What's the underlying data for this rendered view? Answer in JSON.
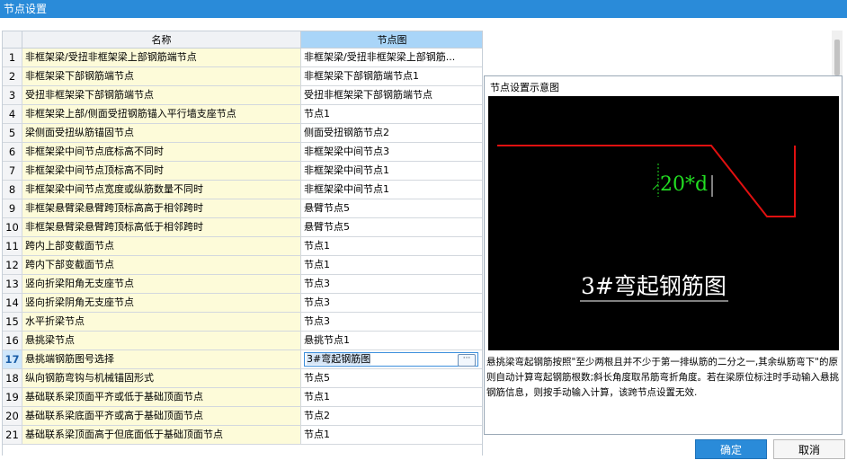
{
  "window": {
    "title": "节点设置"
  },
  "grid": {
    "header_name": "名称",
    "header_node": "节点图",
    "rows": [
      {
        "num": "1",
        "name": "非框架梁/受扭非框架梁上部钢筋端节点",
        "node": "非框架梁/受扭非框架梁上部钢筋..."
      },
      {
        "num": "2",
        "name": "非框架梁下部钢筋端节点",
        "node": "非框架梁下部钢筋端节点1"
      },
      {
        "num": "3",
        "name": "受扭非框架梁下部钢筋端节点",
        "node": "受扭非框架梁下部钢筋端节点"
      },
      {
        "num": "4",
        "name": "非框架梁上部/侧面受扭钢筋锚入平行墙支座节点",
        "node": "节点1"
      },
      {
        "num": "5",
        "name": "梁侧面受扭纵筋锚固节点",
        "node": "侧面受扭钢筋节点2"
      },
      {
        "num": "6",
        "name": "非框架梁中间节点底标高不同时",
        "node": "非框架梁中间节点3"
      },
      {
        "num": "7",
        "name": "非框架梁中间节点顶标高不同时",
        "node": "非框架梁中间节点1"
      },
      {
        "num": "8",
        "name": "非框架梁中间节点宽度或纵筋数量不同时",
        "node": "非框架梁中间节点1"
      },
      {
        "num": "9",
        "name": "非框架悬臂梁悬臂跨顶标高高于相邻跨时",
        "node": "悬臂节点5"
      },
      {
        "num": "10",
        "name": "非框架悬臂梁悬臂跨顶标高低于相邻跨时",
        "node": "悬臂节点5"
      },
      {
        "num": "11",
        "name": "跨内上部变截面节点",
        "node": "节点1"
      },
      {
        "num": "12",
        "name": "跨内下部变截面节点",
        "node": "节点1"
      },
      {
        "num": "13",
        "name": "竖向折梁阳角无支座节点",
        "node": "节点3"
      },
      {
        "num": "14",
        "name": "竖向折梁阴角无支座节点",
        "node": "节点3"
      },
      {
        "num": "15",
        "name": "水平折梁节点",
        "node": "节点3"
      },
      {
        "num": "16",
        "name": "悬挑梁节点",
        "node": "悬挑节点1"
      },
      {
        "num": "17",
        "name": "悬挑端钢筋图号选择",
        "node": "3#弯起钢筋图",
        "selected": true
      },
      {
        "num": "18",
        "name": "纵向钢筋弯钩与机械锚固形式",
        "node": "节点5"
      },
      {
        "num": "19",
        "name": "基础联系梁顶面平齐或低于基础顶面节点",
        "node": "节点1"
      },
      {
        "num": "20",
        "name": "基础联系梁底面平齐或高于基础顶面节点",
        "node": "节点2"
      },
      {
        "num": "21",
        "name": "基础联系梁顶面高于但底面低于基础顶面节点",
        "node": "节点1"
      }
    ]
  },
  "editor": {
    "ellipsis_label": "···"
  },
  "panel": {
    "title": "节点设置示意图",
    "diagram_dim": "20*d",
    "diagram_caption": "3#弯起钢筋图",
    "description": "悬挑梁弯起钢筋按照\"至少两根且并不少于第一排纵筋的二分之一,其余纵筋弯下\"的原则自动计算弯起钢筋根数;斜长角度取吊筋弯折角度。若在梁原位标注时手动输入悬挑钢筋信息，则按手动输入计算，该跨节点设置无效.",
    "colors": {
      "rebar": "#e01010",
      "dim": "#22dd22",
      "caption": "#ffffff",
      "background": "#000000"
    }
  },
  "buttons": {
    "ok": "确定",
    "cancel": "取消"
  }
}
